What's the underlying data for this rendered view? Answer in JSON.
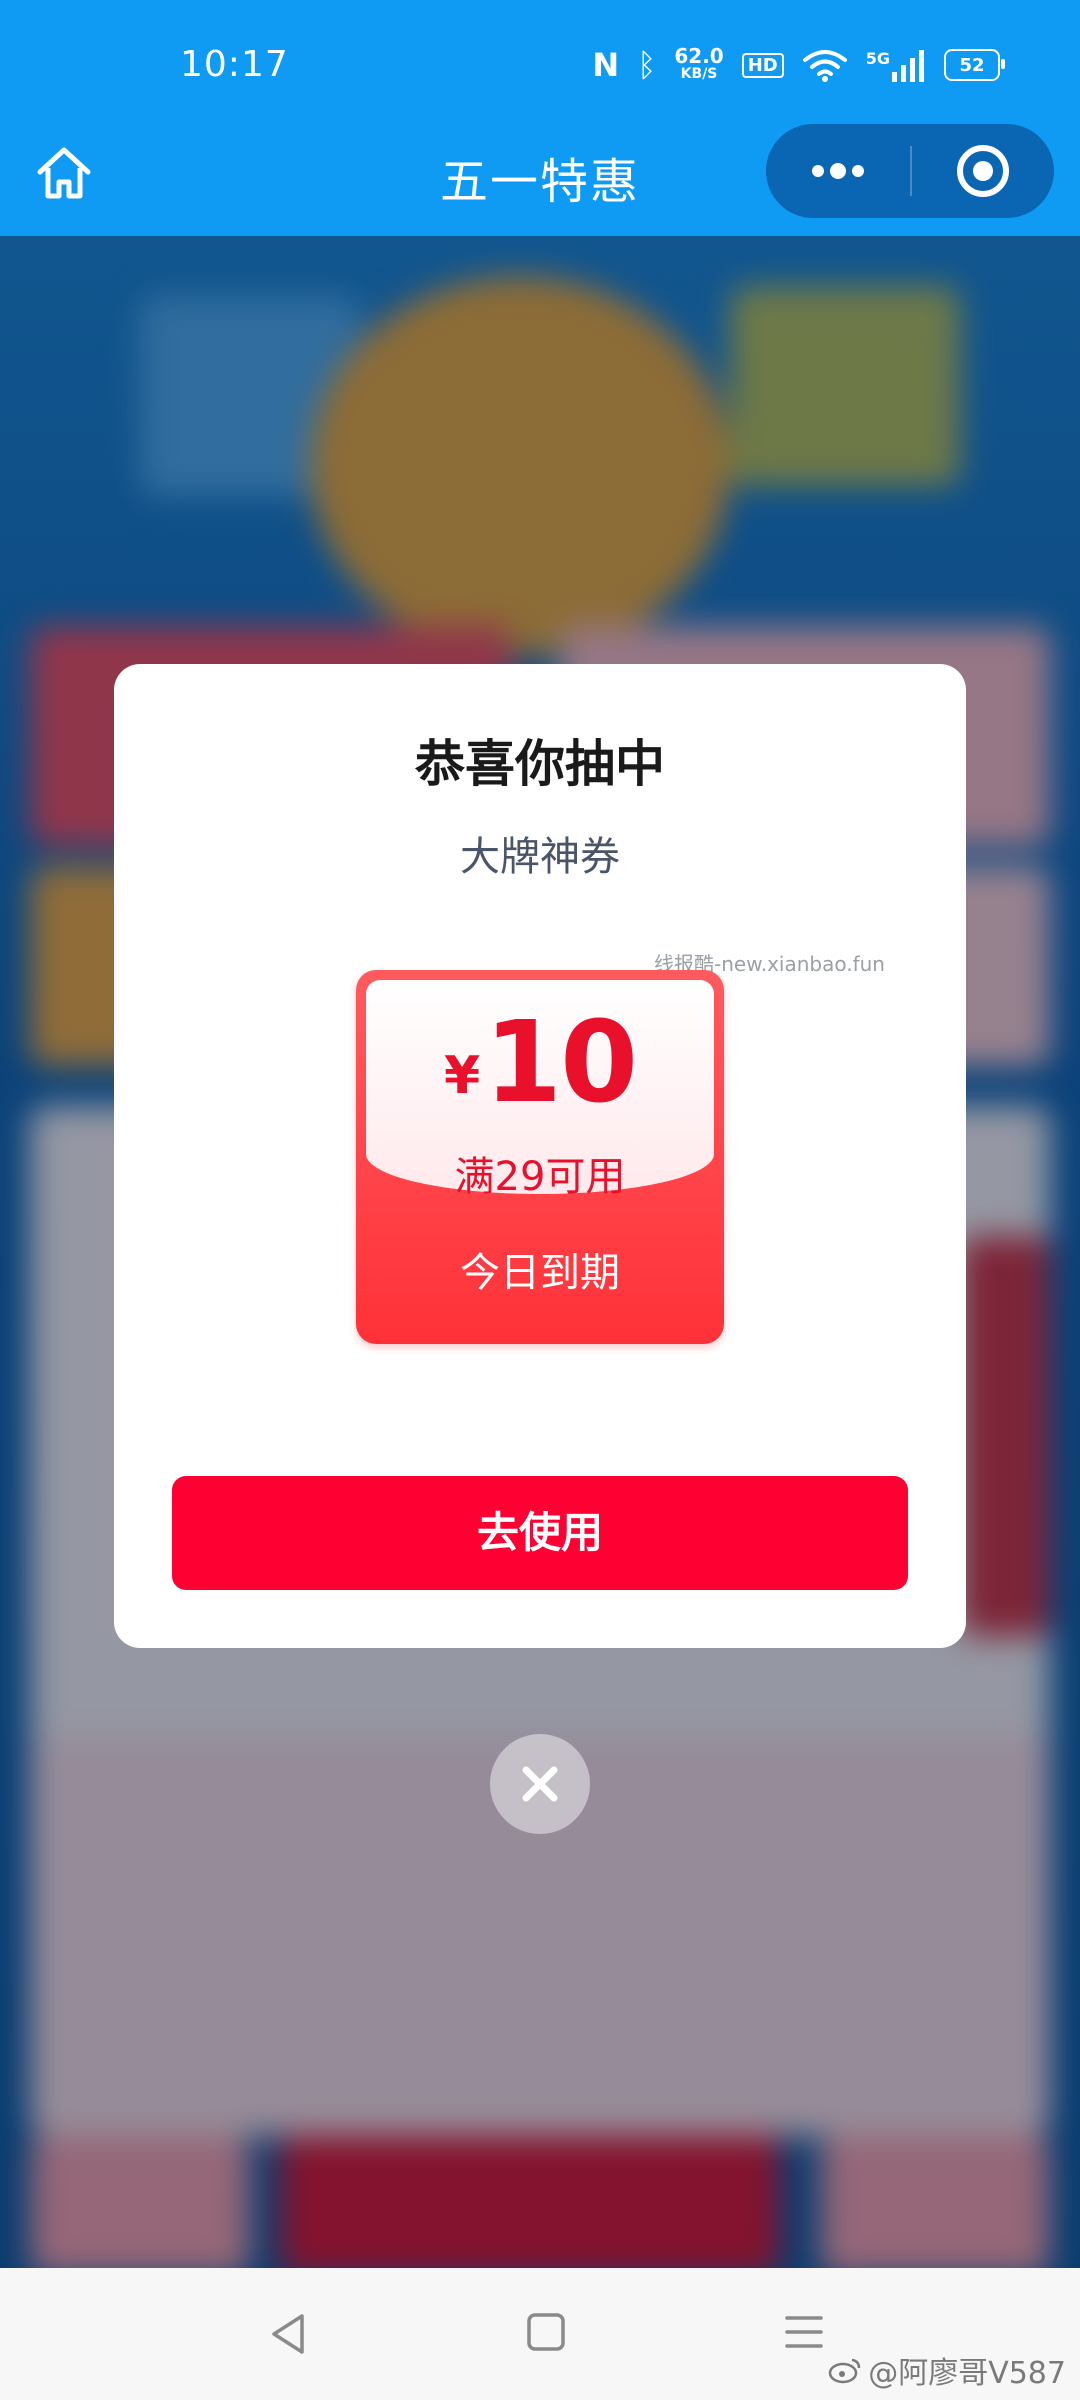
{
  "status_bar": {
    "time": "10:17",
    "net_speed_value": "62.0",
    "net_speed_unit": "KB/S",
    "hd_label": "HD",
    "network_type": "5G",
    "battery": "52"
  },
  "nav": {
    "title": "五一特惠"
  },
  "modal": {
    "title": "恭喜你抽中",
    "subtitle": "大牌神券",
    "watermark": "线报酷-new.xianbao.fun",
    "coupon": {
      "currency": "¥",
      "amount": "10",
      "condition": "满29可用",
      "expiry": "今日到期"
    },
    "use_button": "去使用"
  },
  "footer_watermark": "@阿廖哥V587",
  "colors": {
    "nav_blue": "#0f9bf3",
    "coupon_red": "#ff3138",
    "button_red": "#ff0033"
  }
}
